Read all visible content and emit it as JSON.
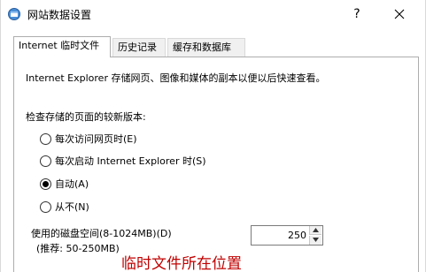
{
  "window": {
    "title": "网站数据设置",
    "help_label": "?"
  },
  "tabs": [
    {
      "label": "Internet 临时文件",
      "active": true
    },
    {
      "label": "历史记录",
      "active": false
    },
    {
      "label": "缓存和数据库",
      "active": false
    }
  ],
  "temp_files": {
    "description": "Internet Explorer 存储网页、图像和媒体的副本以便以后快速查看。",
    "check_label": "检查存储的页面的较新版本:",
    "options": [
      {
        "label": "每次访问网页时(E)",
        "checked": false
      },
      {
        "label": "每次启动 Internet Explorer 时(S)",
        "checked": false
      },
      {
        "label": "自动(A)",
        "checked": true
      },
      {
        "label": "从不(N)",
        "checked": false
      }
    ],
    "disk_space_label": "使用的磁盘空间(8-1024MB)(D)",
    "disk_space_hint": "(推荐: 50-250MB)",
    "disk_space_value": "250"
  },
  "annotation": {
    "text": "临时文件所在位置",
    "color": "#c00000"
  }
}
